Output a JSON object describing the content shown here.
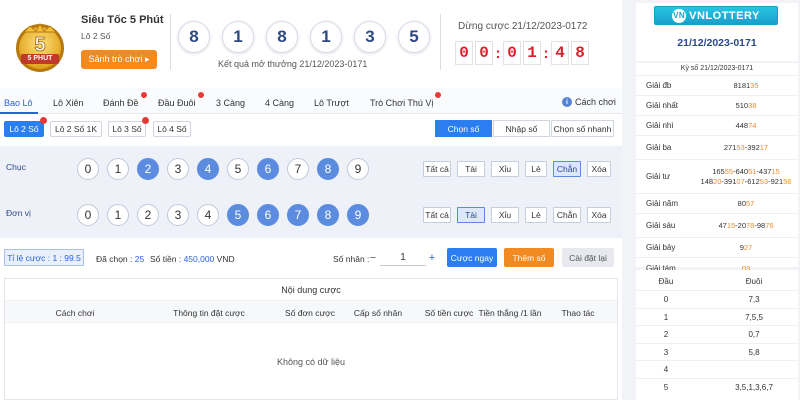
{
  "header": {
    "title": "Siêu Tốc 5 Phút",
    "subtitle": "Lô 2 Số",
    "logo_text": "5 PHÚT",
    "guide_label": "Sảnh trò chơi ▸",
    "result_balls": [
      "8",
      "1",
      "8",
      "1",
      "3",
      "5"
    ],
    "result_label": "Kết quả mở thưởng 21/12/2023-0171",
    "stop_label": "Dừng cược 21/12/2023-0172",
    "countdown": [
      "0",
      "0",
      "0",
      "1",
      "4",
      "8"
    ]
  },
  "tabs": [
    {
      "label": "Bao Lô",
      "active": true,
      "badge": false
    },
    {
      "label": "Lô Xiên",
      "active": false,
      "badge": false
    },
    {
      "label": "Đánh Đề",
      "active": false,
      "badge": true
    },
    {
      "label": "Đầu Đuôi",
      "active": false,
      "badge": true
    },
    {
      "label": "3 Càng",
      "active": false,
      "badge": false
    },
    {
      "label": "4 Càng",
      "active": false,
      "badge": false
    },
    {
      "label": "Lô Trượt",
      "active": false,
      "badge": false
    },
    {
      "label": "Trò Chơi Thú Vị",
      "active": false,
      "badge": true
    }
  ],
  "help_label": "Cách chơi",
  "help_icon": "i",
  "subtabs": [
    {
      "label": "Lô 2 Số",
      "active": true,
      "badge": true
    },
    {
      "label": "Lô 2 Số 1K",
      "active": false,
      "badge": false
    },
    {
      "label": "Lô 3 Số",
      "active": false,
      "badge": true
    },
    {
      "label": "Lô 4 Số",
      "active": false,
      "badge": false
    }
  ],
  "modes": [
    {
      "label": "Chọn số",
      "active": true
    },
    {
      "label": "Nhập số",
      "active": false
    },
    {
      "label": "Chọn số nhanh",
      "active": false
    }
  ],
  "rows": [
    {
      "label": "Chục",
      "numbers": [
        "0",
        "1",
        "2",
        "3",
        "4",
        "5",
        "6",
        "7",
        "8",
        "9"
      ],
      "selected": [
        2,
        4,
        6,
        8
      ],
      "quick": [
        "Tất cả",
        "Tài",
        "Xỉu",
        "Lẻ",
        "Chẵn",
        "Xóa"
      ],
      "quick_selected": "Chẵn"
    },
    {
      "label": "Đơn vị",
      "numbers": [
        "0",
        "1",
        "2",
        "3",
        "4",
        "5",
        "6",
        "7",
        "8",
        "9"
      ],
      "selected": [
        5,
        6,
        7,
        8,
        9
      ],
      "quick": [
        "Tất cả",
        "Tài",
        "Xỉu",
        "Lẻ",
        "Chẵn",
        "Xóa"
      ],
      "quick_selected": "Tài"
    }
  ],
  "betbar": {
    "ratio": "Tỉ lệ cược : 1 : 99.5",
    "chosen_label": "Đã chọn :",
    "chosen_value": "25",
    "amount_label": "Số tiền :",
    "amount_value": "450,000",
    "amount_unit": "VND",
    "multiplier_label": "Số nhân :",
    "minus": "−",
    "plus": "+",
    "multiplier_value": "1",
    "quick_bet": "Cược ngay",
    "add_number": "Thêm số",
    "reset": "Cài đặt lại"
  },
  "content": {
    "title": "Nội dung cược",
    "columns": [
      "Cách chơi",
      "Thông tin đặt cược",
      "Số đơn cược",
      "Cấp số nhân",
      "Số tiền cược",
      "Tiền thắng /1 lần",
      "Thao tác"
    ],
    "empty": "Không có dữ liệu"
  },
  "right": {
    "brand": "VNLOTTERY",
    "brand_badge": "VN",
    "draw_id": "21/12/2023-0171",
    "results_head": "Kỳ số 21/12/2023-0171",
    "prizes": [
      {
        "name": "Giải đb",
        "nums": [
          [
            "8181",
            "35"
          ]
        ]
      },
      {
        "name": "Giải nhất",
        "nums": [
          [
            "510",
            "38"
          ]
        ]
      },
      {
        "name": "Giải nhì",
        "nums": [
          [
            "448",
            "74"
          ]
        ]
      },
      {
        "name": "Giải ba",
        "nums": [
          [
            "271",
            "53"
          ],
          [
            "-392",
            "17"
          ]
        ]
      },
      {
        "name": "Giải tư",
        "nums": [
          [
            "165",
            "55"
          ],
          [
            "-640",
            "51"
          ],
          [
            "-437",
            "15"
          ],
          [
            "|",
            ""
          ],
          [
            "148",
            "20"
          ],
          [
            "-391",
            "07"
          ],
          [
            "-612",
            "53"
          ],
          [
            "-921",
            "56"
          ]
        ]
      },
      {
        "name": "Giải năm",
        "nums": [
          [
            "80",
            "57"
          ]
        ]
      },
      {
        "name": "Giải sáu",
        "nums": [
          [
            "47",
            "15"
          ],
          [
            "-20",
            "78"
          ],
          [
            "-98",
            "76"
          ]
        ]
      },
      {
        "name": "Giải bảy",
        "nums": [
          [
            "9",
            "27"
          ]
        ]
      },
      {
        "name": "Giải tám",
        "nums": [
          [
            "",
            "03"
          ]
        ]
      }
    ],
    "dd_head": [
      "Đầu",
      "Đuôi"
    ],
    "dd_rows": [
      [
        "0",
        "7,3"
      ],
      [
        "1",
        "7,5,5"
      ],
      [
        "2",
        "0,7"
      ],
      [
        "3",
        "5,8"
      ],
      [
        "4",
        ""
      ],
      [
        "5",
        "3,5,1,3,6,7"
      ]
    ]
  },
  "colors": {
    "accent": "#2b7ef0",
    "orange": "#f28a22",
    "countdown": "#d8202c",
    "selected_ball": "#5b8ce0"
  }
}
